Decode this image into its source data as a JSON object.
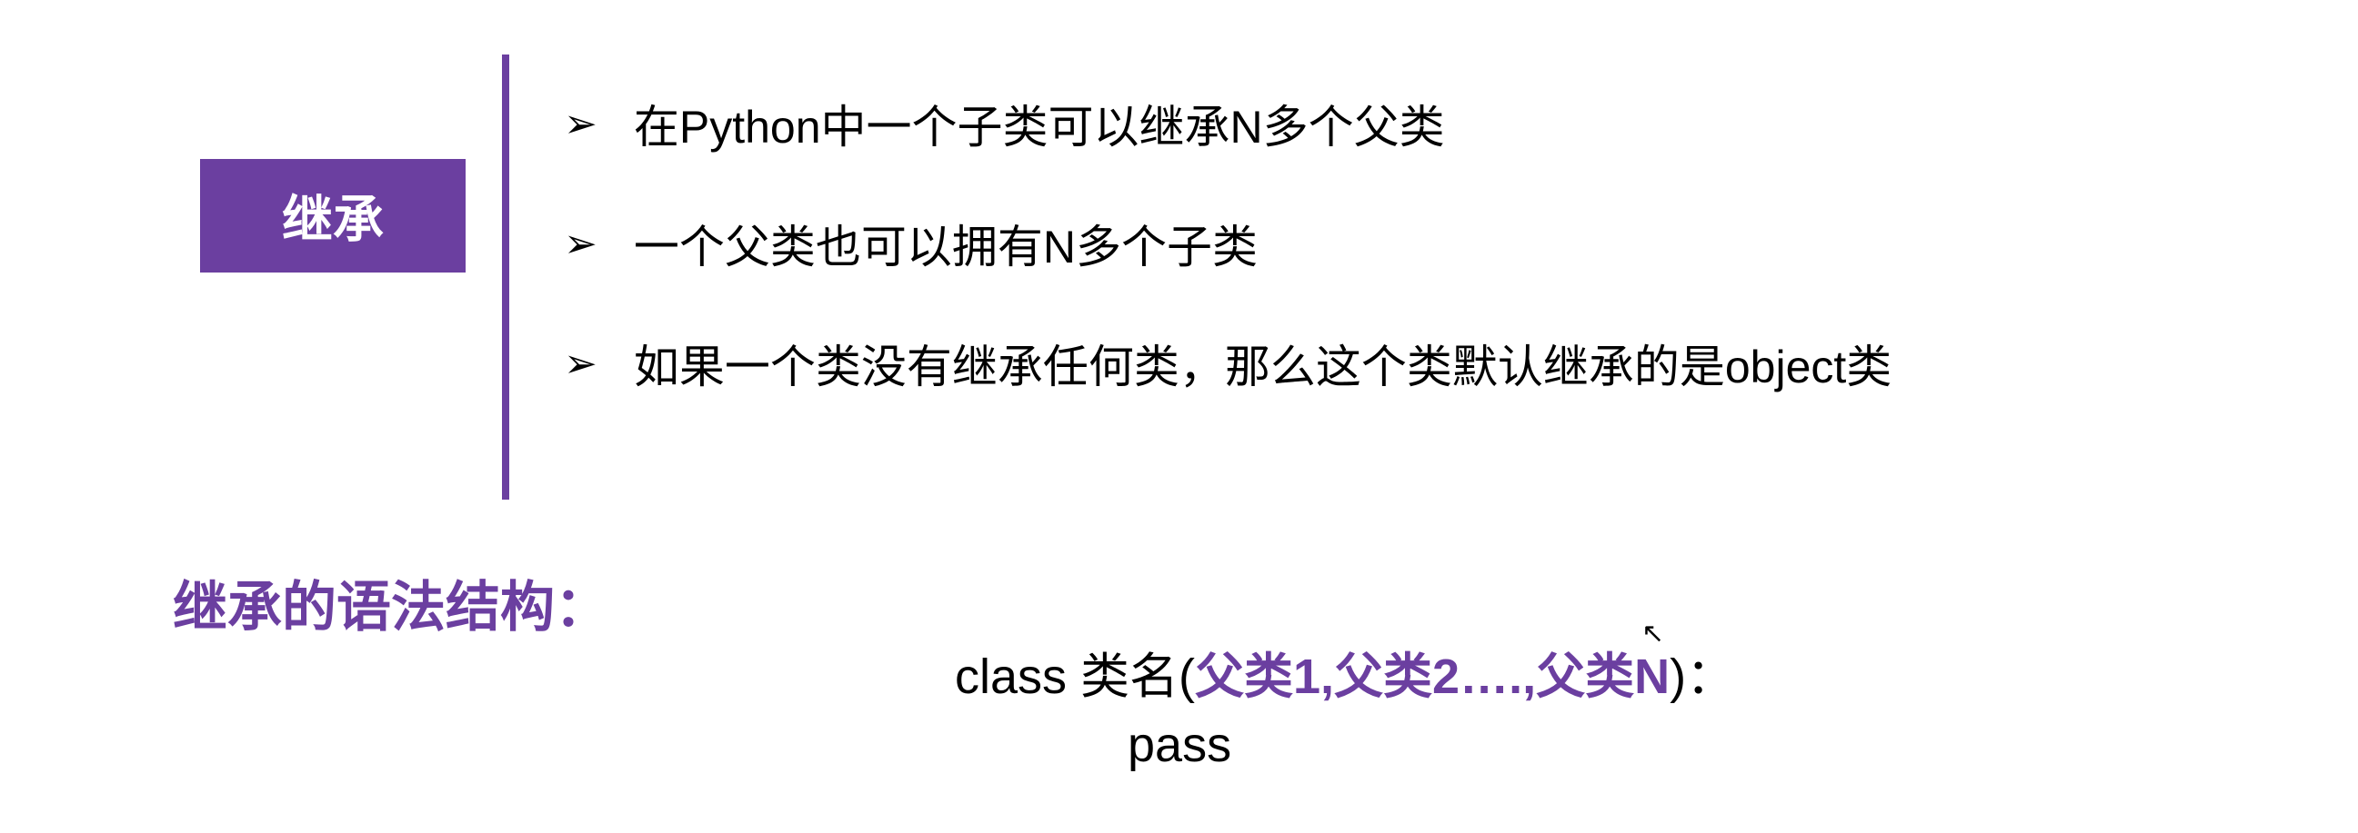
{
  "badge": "继承",
  "bullets": [
    "在Python中一个子类可以继承N多个父类",
    "一个父类也可以拥有N多个子类",
    "如果一个类没有继承任何类，那么这个类默认继承的是object类"
  ],
  "syntax_heading": "继承的语法结构：",
  "code": {
    "prefix": "class 类名(",
    "params": "父类1,父类2….,父类N",
    "suffix": ")：",
    "body": "pass"
  }
}
